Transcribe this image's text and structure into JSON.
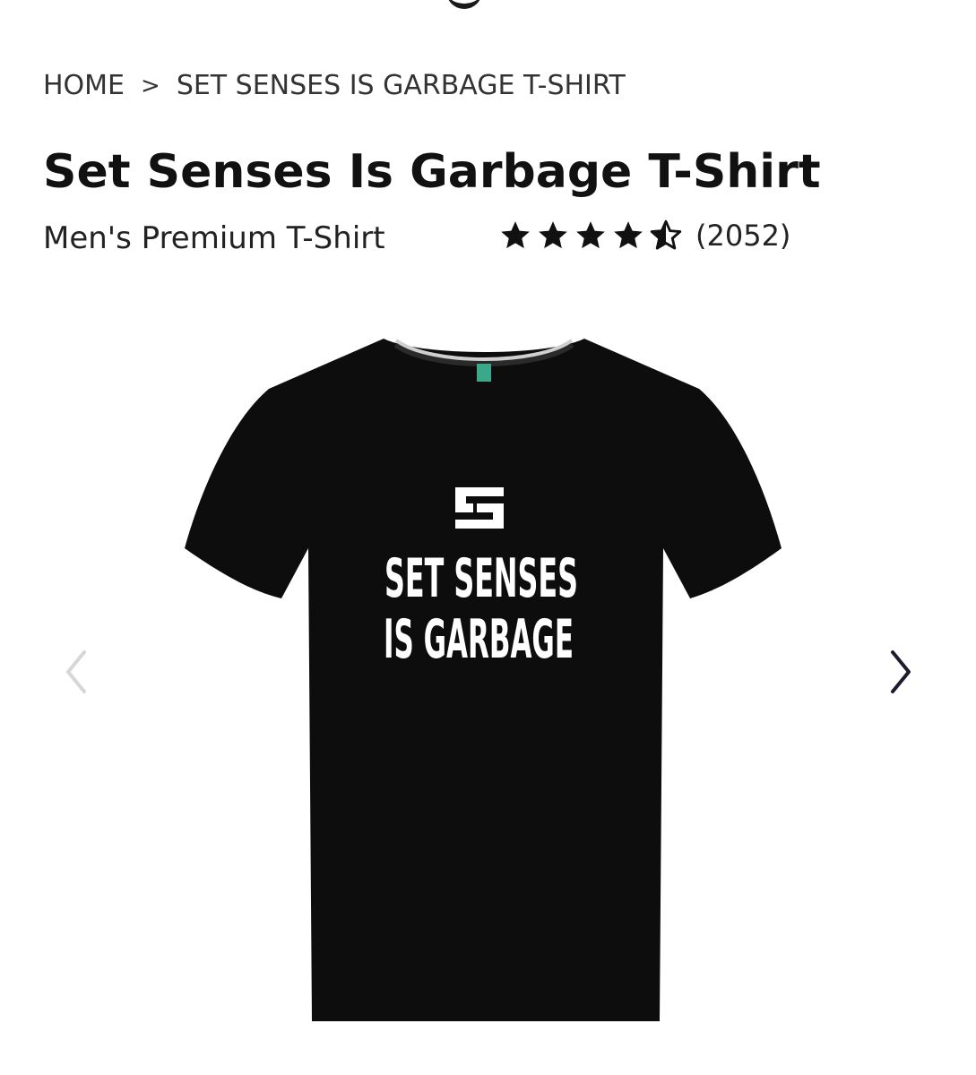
{
  "breadcrumb": {
    "home": "HOME",
    "separator": ">",
    "current": "SET SENSES IS GARBAGE T-SHIRT"
  },
  "product": {
    "title": "Set Senses Is Garbage T-Shirt",
    "subtitle": "Men's Premium T-Shirt",
    "rating_value": 4.5,
    "rating_count": "(2052)",
    "shirt_color": "#0d0d0d",
    "print_line_1": "SET SENSES",
    "print_line_2": "IS GARBAGE"
  },
  "gallery": {
    "prev_icon": "chevron-left-icon",
    "next_icon": "chevron-right-icon"
  },
  "colors": {
    "text": "#111111",
    "star": "#111111",
    "arrow_disabled": "#d0d0d0",
    "arrow_active": "#1c1c2e",
    "label_tag": "#3aa88a"
  }
}
